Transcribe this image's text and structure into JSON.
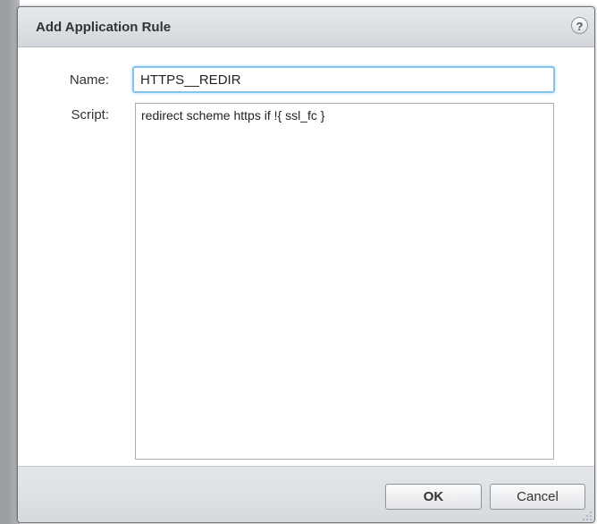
{
  "dialog": {
    "title": "Add Application Rule",
    "help_label": "?"
  },
  "form": {
    "name_label": "Name:",
    "name_value": "HTTPS__REDIR",
    "script_label": "Script:",
    "script_value": "redirect scheme https if !{ ssl_fc }"
  },
  "buttons": {
    "ok_label": "OK",
    "cancel_label": "Cancel"
  },
  "icons": {
    "help": "help-icon",
    "resize": "resize-grip-icon"
  },
  "colors": {
    "focus_border": "#86c4ec",
    "title_bar": "#dde0e3"
  }
}
